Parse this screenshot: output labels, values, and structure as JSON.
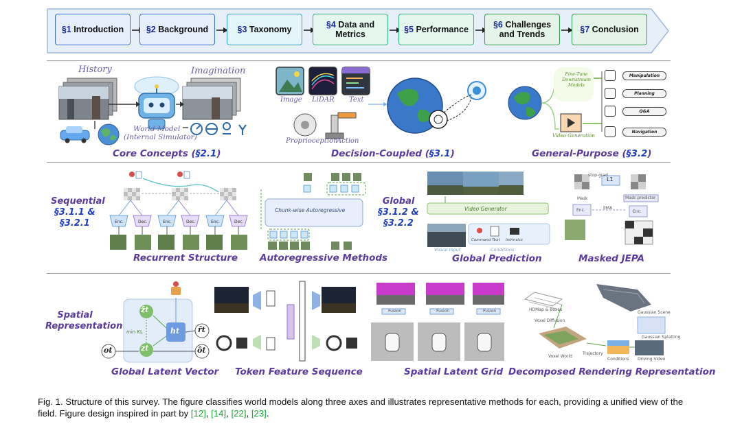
{
  "banner": {
    "steps": [
      {
        "sec": "§1",
        "label": "Introduction",
        "border": "#3c6fd8",
        "fill": "#e6eefc"
      },
      {
        "sec": "§2",
        "label": "Background",
        "border": "#3c6fd8",
        "fill": "#e6eefc"
      },
      {
        "sec": "§3",
        "label": "Taxonomy",
        "border": "#2ea7c7",
        "fill": "#e3f5f9"
      },
      {
        "sec": "§4",
        "label": "Data and Metrics",
        "border": "#32b27d",
        "fill": "#e4f6ee"
      },
      {
        "sec": "§5",
        "label": "Performance",
        "border": "#32b27d",
        "fill": "#e4f6ee"
      },
      {
        "sec": "§6",
        "label": "Challenges and Trends",
        "border": "#2f9e4f",
        "fill": "#e4f4e8"
      },
      {
        "sec": "§7",
        "label": "Conclusion",
        "border": "#2f9e4f",
        "fill": "#e4f4e8"
      }
    ]
  },
  "row1": {
    "core": {
      "history": "History",
      "imagination": "Imagination",
      "world_model": "World Model",
      "simulator": "(Internal Simulator)",
      "caption": "Core Concepts",
      "ref": "§2.1"
    },
    "decision": {
      "image": "Image",
      "lidar": "LiDAR",
      "text": "Text",
      "proprioception": "Proprioception",
      "action": "Action",
      "caption": "Decision-Coupled",
      "ref": "§3.1"
    },
    "general": {
      "finetune": "Fine-Tune Downstream Models",
      "video_gen": "Video Generation",
      "tasks": [
        "Manipulation",
        "Planning",
        "Q&A",
        "Navigation"
      ],
      "caption": "General-Purpose",
      "ref": "§3.2"
    }
  },
  "row2": {
    "sequential_axis": {
      "label": "Sequential",
      "ref": "§3.1.1 & §3.2.1"
    },
    "global_axis": {
      "label": "Global",
      "ref": "§3.1.2 & §3.2.2"
    },
    "recurrent": {
      "enc": "Enc.",
      "dec": "Dec.",
      "caption": "Recurrent Structure"
    },
    "autoregressive": {
      "chunk": "Chunk-wise Autoregressive",
      "caption": "Autoregressive Methods"
    },
    "global_pred": {
      "video_generator": "Video Generator",
      "visual_input": "Visual Input",
      "conditions": "Conditions",
      "command": "Command",
      "text": "Text",
      "intrinsics": "Intrinsics",
      "caption": "Global Prediction"
    },
    "masked": {
      "stop_grad": "stop-grad",
      "l1": "L1",
      "mask": "Mask",
      "ema": "EMA",
      "mask_predictor": "Mask predictor",
      "enc": "Enc.",
      "caption": "Masked JEPA"
    }
  },
  "row3": {
    "spatial_axis": {
      "label": "Spatial Representation"
    },
    "latent": {
      "z_hat": "ẑt",
      "z": "zt",
      "h": "ht",
      "r": "r̂t",
      "o_hat": "ôt",
      "o": "ot",
      "min_kl": "min KL",
      "caption": "Global Latent Vector"
    },
    "token": {
      "caption": "Token Feature Sequence"
    },
    "grid": {
      "fusion": "Fusion",
      "caption": "Spatial Latent Grid"
    },
    "decomposed": {
      "hdmap": "HDMap & Boxes",
      "voxel_diffusion": "Voxel Diffusion",
      "voxel_world": "Voxel World",
      "trajectory": "Trajectory",
      "conditions": "Conditions",
      "driving_video": "Driving Video",
      "gaussian_scene": "Gaussian Scene",
      "gaussian_splatting": "Gaussian Splatting",
      "caption": "Decomposed Rendering Representation"
    }
  },
  "figure_caption": {
    "prefix": "Fig. 1. Structure of this survey. The figure classifies world models along three axes and illustrates representative methods for each, providing a unified view of the field. Figure design inspired in part by ",
    "refs": [
      "[12]",
      "[14]",
      "[22]",
      "[23]"
    ],
    "suffix": "."
  }
}
